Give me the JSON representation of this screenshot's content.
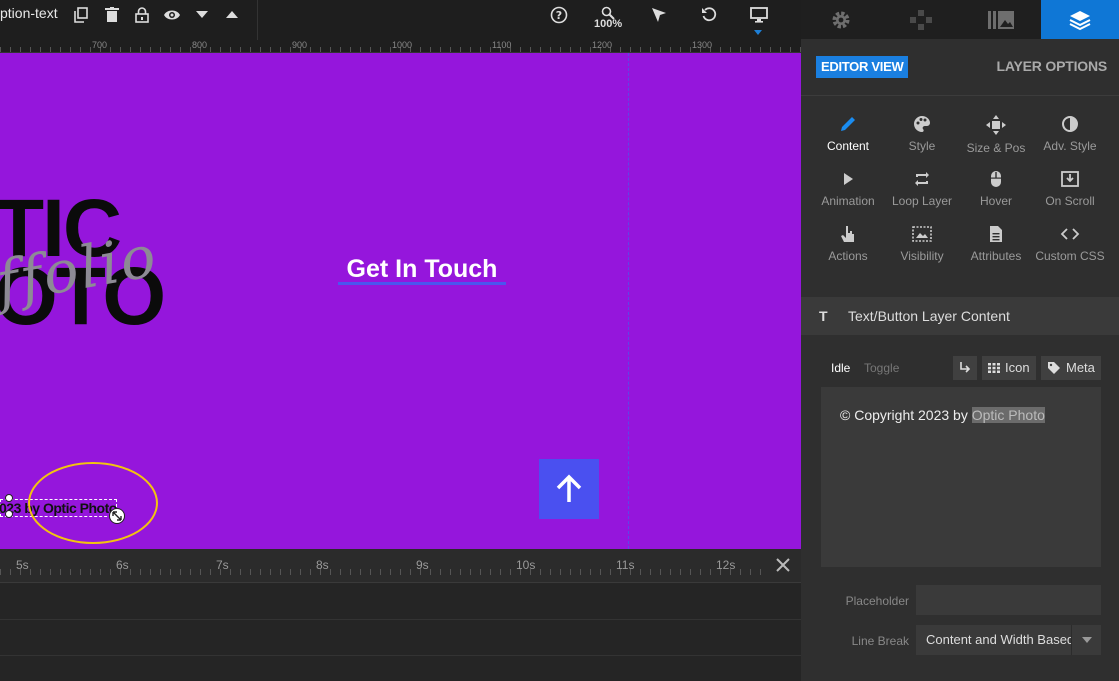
{
  "toolbar": {
    "layer_name": "ption-text",
    "zoom": "100%",
    "icons": [
      "duplicate-icon",
      "delete-icon",
      "lock-icon",
      "visibility-icon",
      "move-down-icon",
      "move-up-icon",
      "help-icon",
      "zoom-icon",
      "select-pointer-icon",
      "undo-icon",
      "desktop-icon"
    ]
  },
  "ruler": {
    "labels": [
      "700",
      "800",
      "900",
      "1000",
      "1100",
      "1200",
      "1300"
    ]
  },
  "canvas": {
    "background": "#9516dc",
    "logo_bold": "TIC\nOTO",
    "logo_script": "ffolio",
    "cta_text": "Get In Touch",
    "copyright_layer_text": "023 by Optic Photo",
    "accent": "#4a50f0",
    "highlight": "#f2c40f"
  },
  "timeline": {
    "labels": [
      "5s",
      "6s",
      "7s",
      "8s",
      "9s",
      "10s",
      "11s",
      "12s"
    ]
  },
  "panel": {
    "tabs": [
      "settings-icon",
      "addons-icon",
      "media-icon",
      "layers-icon"
    ],
    "active_tab": "layers-icon",
    "editor_view": "EDITOR VIEW",
    "layer_options": "LAYER OPTIONS",
    "options": [
      {
        "label": "Content",
        "icon": "pencil-icon",
        "active": true
      },
      {
        "label": "Style",
        "icon": "palette-icon"
      },
      {
        "label": "Size & Pos",
        "icon": "move-icon"
      },
      {
        "label": "Adv. Style",
        "icon": "contrast-icon"
      },
      {
        "label": "Animation",
        "icon": "play-icon"
      },
      {
        "label": "Loop Layer",
        "icon": "loop-icon"
      },
      {
        "label": "Hover",
        "icon": "mouse-icon"
      },
      {
        "label": "On Scroll",
        "icon": "scroll-download-icon"
      },
      {
        "label": "Actions",
        "icon": "hand-pointer-icon"
      },
      {
        "label": "Visibility",
        "icon": "visibility-image-icon"
      },
      {
        "label": "Attributes",
        "icon": "document-icon"
      },
      {
        "label": "Custom CSS",
        "icon": "code-icon"
      }
    ],
    "section_title": "Text/Button Layer Content",
    "section_icon_letter": "T",
    "content_tab_idle": "Idle",
    "content_tab_toggle": "Toggle",
    "icon_button": "Icon",
    "meta_button": "Meta",
    "content_prefix": "© Copyright 2023 by ",
    "content_selected": "Optic Photo",
    "placeholder_label": "Placeholder",
    "placeholder_value": "",
    "line_break_label": "Line Break",
    "line_break_value": "Content and Width Based"
  }
}
